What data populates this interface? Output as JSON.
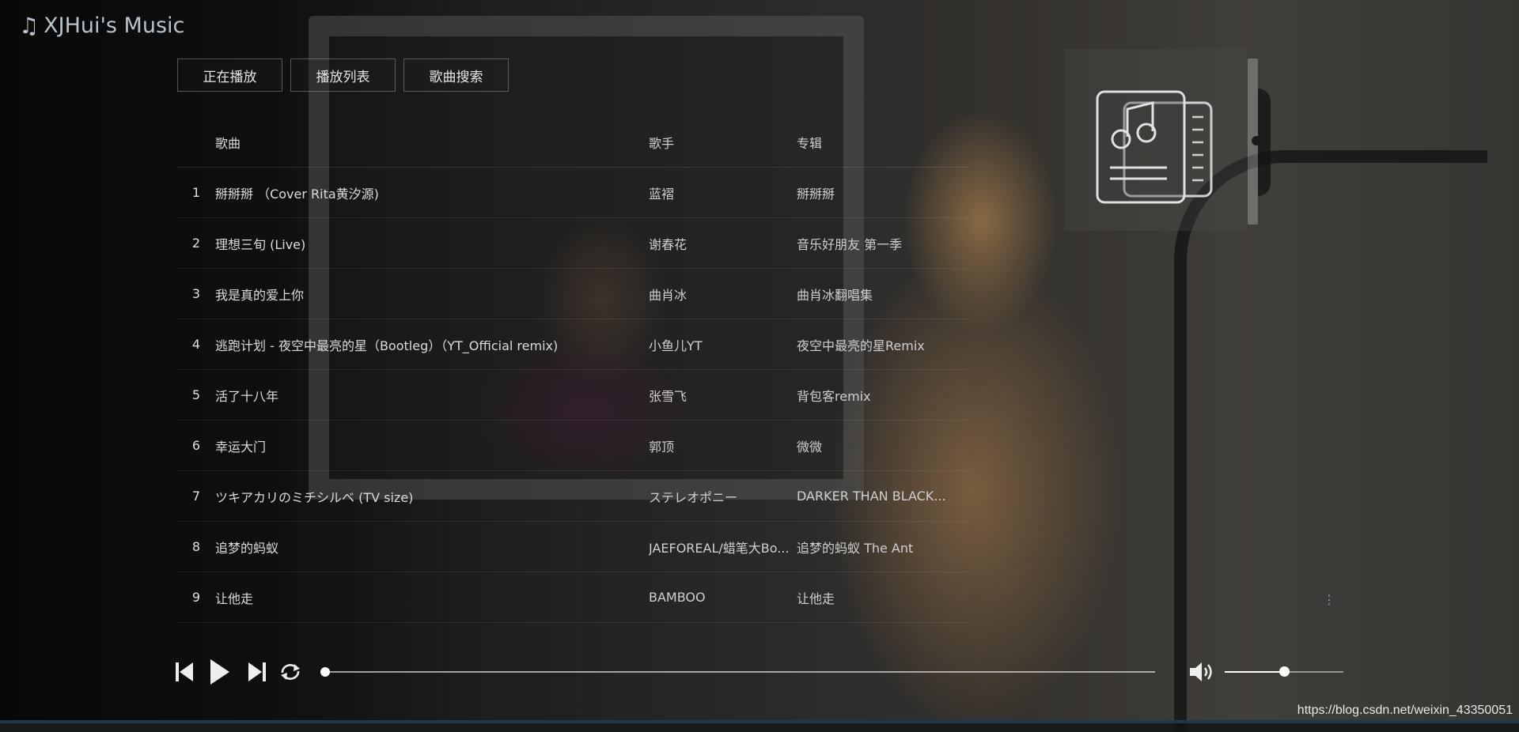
{
  "app": {
    "title": "XJHui's Music"
  },
  "tabs": [
    {
      "label": "正在播放"
    },
    {
      "label": "播放列表"
    },
    {
      "label": "歌曲搜索"
    }
  ],
  "list": {
    "headers": {
      "song": "歌曲",
      "artist": "歌手",
      "album": "专辑"
    },
    "rows": [
      {
        "num": "1",
        "song": "掰掰掰 （Cover Rita黄汐源)",
        "artist": "蓝褶",
        "album": "掰掰掰"
      },
      {
        "num": "2",
        "song": "理想三旬 (Live)",
        "artist": "谢春花",
        "album": "音乐好朋友 第一季"
      },
      {
        "num": "3",
        "song": "我是真的爱上你",
        "artist": "曲肖冰",
        "album": "曲肖冰翻唱集"
      },
      {
        "num": "4",
        "song": "逃跑计划 - 夜空中最亮的星（Bootleg）（YT_Official remix)",
        "artist": "小鱼儿YT",
        "album": "夜空中最亮的星Remix"
      },
      {
        "num": "5",
        "song": "活了十八年",
        "artist": "张雪飞",
        "album": "背包客remix"
      },
      {
        "num": "6",
        "song": "幸运大门",
        "artist": "郭顶",
        "album": "微微"
      },
      {
        "num": "7",
        "song": "ツキアカリのミチシルベ (TV size)",
        "artist": "ステレオポニー",
        "album": "DARKER THAN BLACK..."
      },
      {
        "num": "8",
        "song": "追梦的蚂蚁",
        "artist": "JAEFOREAL/蜡笔大Bo...",
        "album": "追梦的蚂蚁 The Ant"
      },
      {
        "num": "9",
        "song": "让他走",
        "artist": "BAMBOO",
        "album": "让他走"
      }
    ]
  },
  "player": {
    "progress_fraction": 0.0,
    "volume_fraction": 0.5
  },
  "watermark": "https://blog.csdn.net/weixin_43350051",
  "colors": {
    "accent": "#ffffff",
    "text": "#d6d6d6",
    "title": "#b7c3cd"
  }
}
